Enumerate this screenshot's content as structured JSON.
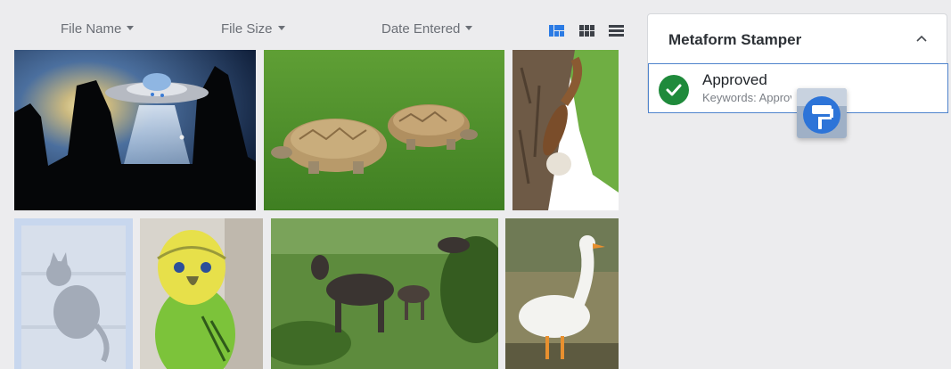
{
  "toolbar": {
    "sort_file_name": "File Name",
    "sort_file_size": "File Size",
    "sort_date_entered": "Date Entered",
    "view_modes": [
      "masonry-view-icon",
      "grid-view-icon",
      "list-view-icon"
    ],
    "active_view": "masonry-view-icon"
  },
  "gallery": {
    "images": [
      {
        "name": "ufo-thumb",
        "subject": "UFO over rock formations"
      },
      {
        "name": "tortoises-thumb",
        "subject": "two tortoises on grass"
      },
      {
        "name": "squirrel-thumb",
        "subject": "squirrel on tree trunk"
      },
      {
        "name": "cat-thumb",
        "subject": "cat silhouette",
        "selected": true
      },
      {
        "name": "parakeet-thumb",
        "subject": "green budgie parakeet"
      },
      {
        "name": "moose-thumb",
        "subject": "moose family in meadow"
      },
      {
        "name": "goose-thumb",
        "subject": "white goose"
      }
    ]
  },
  "metaform_panel": {
    "title": "Metaform Stamper",
    "stamps": [
      {
        "name": "Approved",
        "keywords": "Keywords: Approved"
      }
    ]
  },
  "colors": {
    "accent": "#4f83cc",
    "approved_green": "#1f8a3b",
    "active_view": "#2b7be4"
  }
}
